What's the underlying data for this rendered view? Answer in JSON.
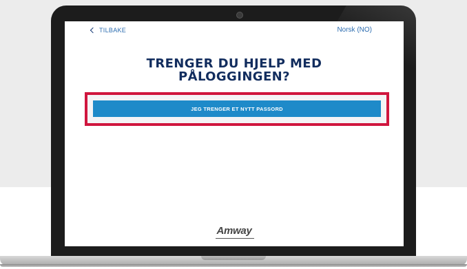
{
  "header": {
    "back_label": "TILBAKE",
    "language_label": "Norsk (NO)"
  },
  "main": {
    "title_line1": "TRENGER DU HJELP MED",
    "title_line2": "PÅLOGGINGEN?",
    "primary_button_label": "JEG TRENGER ET NYTT PASSORD"
  },
  "footer": {
    "brand": "Amway"
  },
  "colors": {
    "title": "#122d5e",
    "link": "#2b6cb0",
    "button": "#1e8ac9",
    "highlight": "#d0163e"
  },
  "icons": {
    "back": "chevron-left-icon",
    "camera": "camera-icon"
  }
}
